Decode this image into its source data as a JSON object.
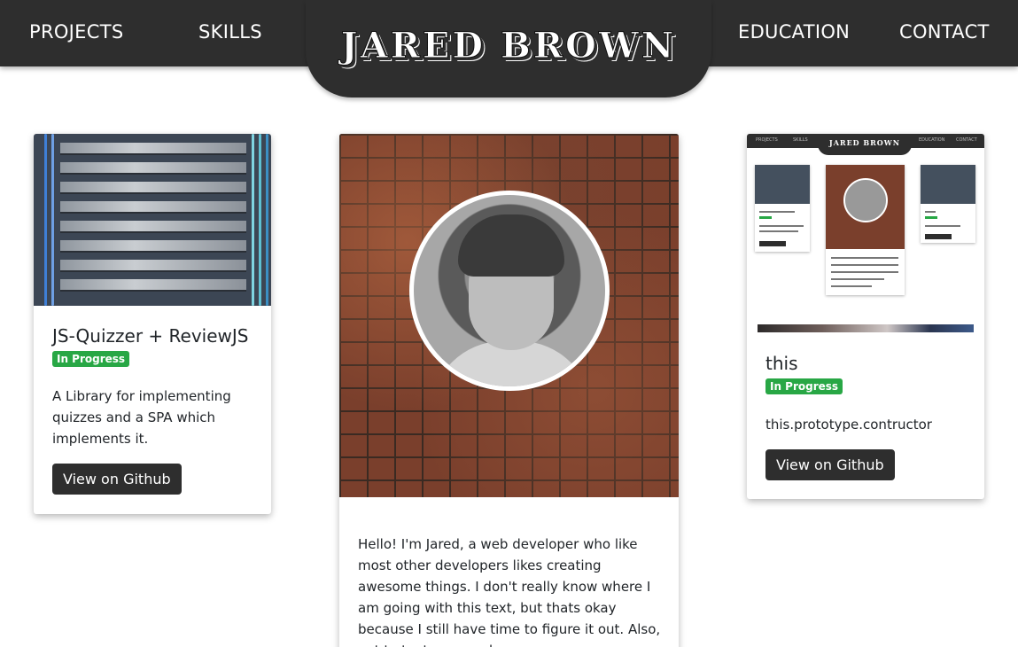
{
  "nav": {
    "projects": "PROJECTS",
    "skills": "SKILLS",
    "brand": "JARED BROWN",
    "education": "EDUCATION",
    "contact": "CONTACT"
  },
  "cards": {
    "left": {
      "title": "JS-Quizzer + ReviewJS",
      "badge": "In Progress",
      "description": "A Library for implementing quizzes and a SPA which implements it.",
      "button": "View on Github"
    },
    "middle": {
      "bio": "Hello! I'm Jared, a web developer who like most other developers likes creating awesome things. I don't really know where I am going with this text, but thats okay because I still have time to figure it out. Also, not to toot my own horn or"
    },
    "right": {
      "title": "this",
      "badge": "In Progress",
      "description": "this.prototype.contructor",
      "button": "View on Github",
      "thumbnail_brand": "JARED BROWN"
    }
  },
  "colors": {
    "nav_bg": "#2e2e2e",
    "badge_green": "#28a745",
    "button_bg": "#2e2e2e"
  }
}
